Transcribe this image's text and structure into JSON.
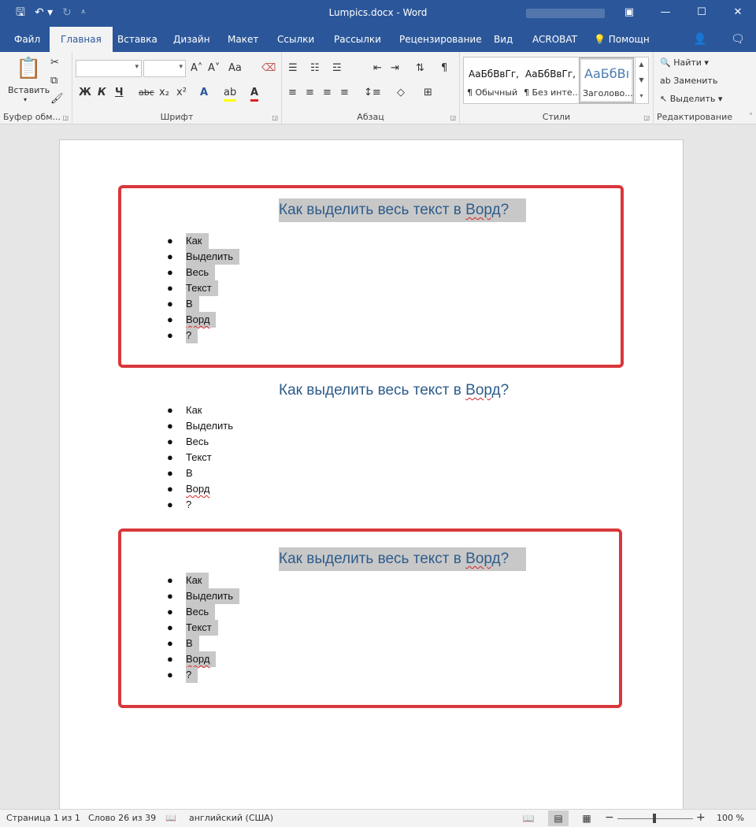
{
  "window": {
    "title": "Lumpics.docx - Word",
    "qat": {
      "save_icon": "save-icon",
      "undo_icon": "undo-icon",
      "redo_icon": "redo-icon",
      "customize_icon": "customize-qat-icon"
    },
    "controls": {
      "ribbon_options": "▣",
      "minimize": "—",
      "maximize": "☐",
      "close": "✕"
    }
  },
  "tabs": [
    {
      "label": "Файл",
      "active": false
    },
    {
      "label": "Главная",
      "active": true
    },
    {
      "label": "Вставка",
      "active": false
    },
    {
      "label": "Дизайн",
      "active": false
    },
    {
      "label": "Макет",
      "active": false
    },
    {
      "label": "Ссылки",
      "active": false
    },
    {
      "label": "Рассылки",
      "active": false
    },
    {
      "label": "Рецензирование",
      "active": false
    },
    {
      "label": "Вид",
      "active": false
    },
    {
      "label": "ACROBAT",
      "active": false
    }
  ],
  "tell_me": "Помощн",
  "ribbon": {
    "clipboard": {
      "paste_label": "Вставить",
      "group_label": "Буфер обм..."
    },
    "font": {
      "font_name": "",
      "font_size": "",
      "group_label": "Шрифт",
      "bold": "Ж",
      "italic": "К",
      "underline": "Ч",
      "strike": "abc",
      "subscript": "x₂",
      "superscript": "x²",
      "grow": "A˄",
      "shrink": "A˅",
      "change_case": "Aa",
      "font_color": "A"
    },
    "paragraph": {
      "group_label": "Абзац",
      "pilcrow": "¶"
    },
    "styles": {
      "group_label": "Стили",
      "items": [
        {
          "sample": "АаБбВвГг,",
          "name": "¶ Обычный"
        },
        {
          "sample": "АаБбВвГг,",
          "name": "¶ Без инте..."
        },
        {
          "sample": "АаБбВı",
          "name": "Заголово..."
        }
      ]
    },
    "editing": {
      "group_label": "Редактирование",
      "find": "Найти",
      "replace": "Заменить",
      "select": "Выделить"
    }
  },
  "document": {
    "heading_before": "Как выделить весь текст в ",
    "heading_word": "Ворд",
    "heading_after": "?",
    "items": [
      "Как",
      "Выделить",
      "Весь",
      "Текст",
      "В",
      "Ворд",
      "?"
    ]
  },
  "status": {
    "page": "Страница 1 из 1",
    "words": "Слово 26 из 39",
    "language": "английский (США)",
    "zoom": "100 %",
    "zoom_level_percent": 100
  },
  "colors": {
    "accent": "#2b579a",
    "highlight": "#c8c8c8",
    "annotation": "#d9373b",
    "heading": "#2e5c8a"
  }
}
